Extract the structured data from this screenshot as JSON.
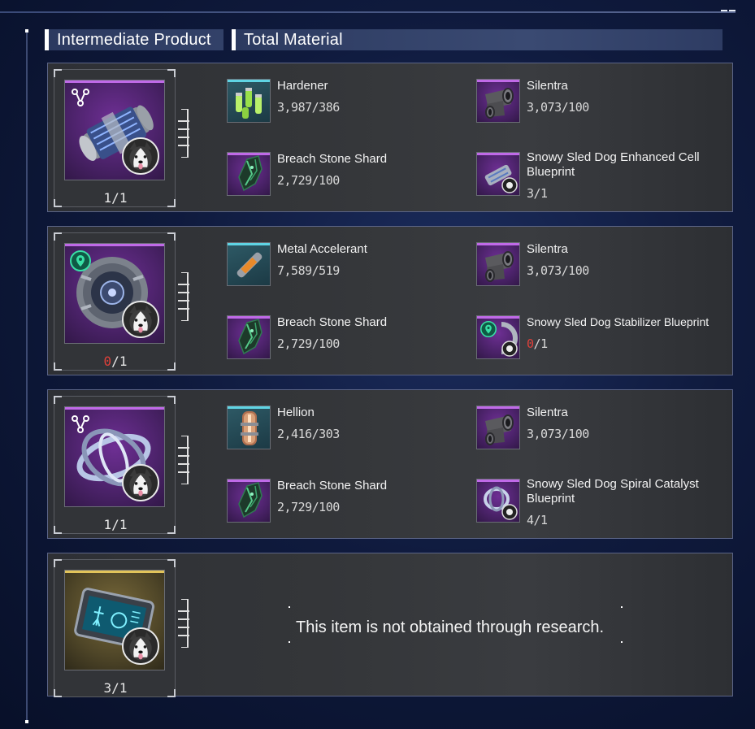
{
  "tabs": {
    "intermediate": "Intermediate Product",
    "total": "Total Material"
  },
  "colors": {
    "purple_rarity": "#a44bd6",
    "gold_rarity": "#d7b84a",
    "teal_rarity": "#3fb4c4",
    "insufficient": "#e0403a"
  },
  "cards": [
    {
      "product_icon": "enhanced-cell-canister",
      "type_icon": "node-tree-icon",
      "count_have": "1",
      "count_sep": "/",
      "count_need": "1",
      "materials": [
        {
          "name": "Hardener",
          "qty": "3,987/386",
          "icon": "hardener-vials"
        },
        {
          "name": "Silentra",
          "qty": "3,073/100",
          "icon": "silentra-pipes"
        },
        {
          "name": "Breach Stone Shard",
          "qty": "2,729/100",
          "icon": "breach-stone-shard"
        },
        {
          "name": "Snowy Sled Dog Enhanced Cell Blueprint",
          "qty": "3/1",
          "icon": "blueprint-enhanced-cell"
        }
      ]
    },
    {
      "product_icon": "stabilizer-ring",
      "type_icon": "location-pin-badge",
      "count_have": "0",
      "count_sep": "/",
      "count_need": "1",
      "materials": [
        {
          "name": "Metal Accelerant",
          "qty": "7,589/519",
          "icon": "metal-accelerant-tube"
        },
        {
          "name": "Silentra",
          "qty": "3,073/100",
          "icon": "silentra-pipes"
        },
        {
          "name": "Breach Stone Shard",
          "qty": "2,729/100",
          "icon": "breach-stone-shard"
        },
        {
          "name": "Snowy Sled Dog Stabilizer Blueprint",
          "qty_have": "0",
          "qty_sep": "/",
          "qty_need": "1",
          "icon": "blueprint-stabilizer"
        }
      ]
    },
    {
      "product_icon": "spiral-catalyst-rings",
      "type_icon": "node-tree-icon",
      "count_have": "1",
      "count_sep": "/",
      "count_need": "1",
      "materials": [
        {
          "name": "Hellion",
          "qty": "2,416/303",
          "icon": "hellion-capsule"
        },
        {
          "name": "Silentra",
          "qty": "3,073/100",
          "icon": "silentra-pipes"
        },
        {
          "name": "Breach Stone Shard",
          "qty": "2,729/100",
          "icon": "breach-stone-shard"
        },
        {
          "name": "Snowy Sled Dog Spiral Catalyst Blueprint",
          "qty": "4/1",
          "icon": "blueprint-spiral-catalyst"
        }
      ]
    },
    {
      "product_icon": "holo-tablet",
      "count_have": "3",
      "count_sep": "/",
      "count_need": "1",
      "message": "This item is not obtained through research."
    }
  ]
}
